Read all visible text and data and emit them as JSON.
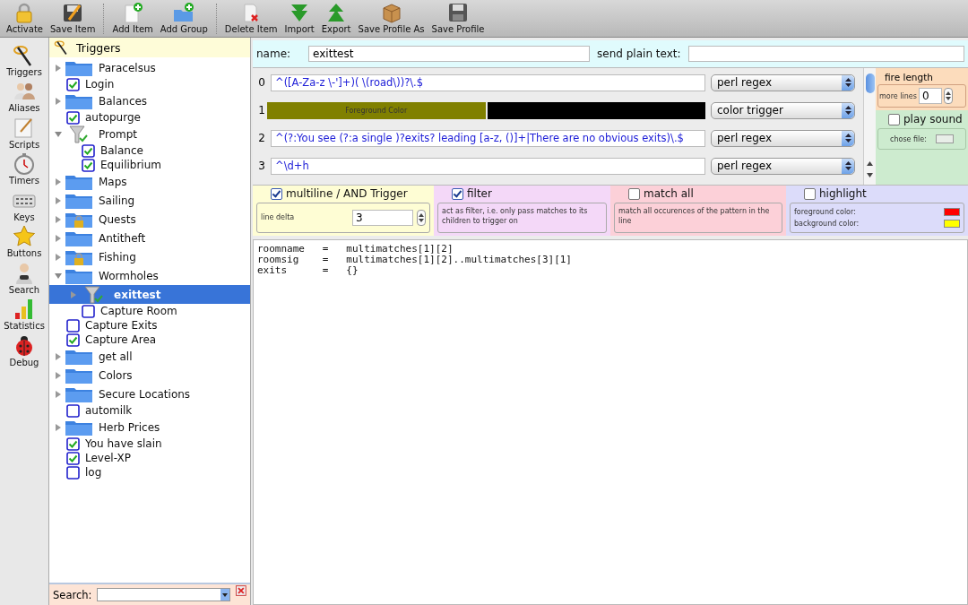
{
  "toolbar": [
    [
      {
        "label": "Activate",
        "kind": "lock"
      },
      {
        "label": "Save Item",
        "kind": "save"
      }
    ],
    [
      {
        "label": "Add Item",
        "kind": "add-item"
      },
      {
        "label": "Add Group",
        "kind": "add-group"
      }
    ],
    [
      {
        "label": "Delete Item",
        "kind": "delete"
      },
      {
        "label": "Import",
        "kind": "import"
      },
      {
        "label": "Export",
        "kind": "export"
      },
      {
        "label": "Save Profile As",
        "kind": "box"
      },
      {
        "label": "Save Profile",
        "kind": "disk"
      }
    ]
  ],
  "sidebar": {
    "items": [
      {
        "label": "Triggers",
        "kind": "wand"
      },
      {
        "label": "Aliases",
        "kind": "people"
      },
      {
        "label": "Scripts",
        "kind": "notepad"
      },
      {
        "label": "Timers",
        "kind": "stopwatch"
      },
      {
        "label": "Keys",
        "kind": "keyboard"
      },
      {
        "label": "Buttons",
        "kind": "star"
      },
      {
        "label": "Search",
        "kind": "person"
      },
      {
        "label": "Statistics",
        "kind": "bars"
      },
      {
        "label": "Debug",
        "kind": "ladybug"
      }
    ]
  },
  "tree": {
    "header": "Triggers",
    "items": [
      {
        "label": "Paracelsus",
        "kind": "folder",
        "locked": false,
        "expanded": false,
        "selected": false
      },
      {
        "label": "Login",
        "kind": "trigger",
        "checked": true,
        "selected": false
      },
      {
        "label": "Balances",
        "kind": "folder",
        "locked": false,
        "expanded": false,
        "selected": false
      },
      {
        "label": "autopurge",
        "kind": "trigger",
        "checked": true,
        "selected": false
      },
      {
        "label": "Prompt",
        "kind": "filter",
        "expanded": true,
        "selected": false,
        "children": [
          {
            "label": "Balance",
            "kind": "trigger",
            "checked": true,
            "selected": false
          },
          {
            "label": "Equilibrium",
            "kind": "trigger",
            "checked": true,
            "selected": false
          }
        ]
      },
      {
        "label": "Maps",
        "kind": "folder",
        "locked": false,
        "expanded": false,
        "selected": false
      },
      {
        "label": "Sailing",
        "kind": "folder",
        "locked": false,
        "expanded": false,
        "selected": false
      },
      {
        "label": "Quests",
        "kind": "folder",
        "locked": true,
        "expanded": false,
        "selected": false
      },
      {
        "label": "Antitheft",
        "kind": "folder",
        "locked": false,
        "expanded": false,
        "selected": false
      },
      {
        "label": "Fishing",
        "kind": "folder",
        "locked": true,
        "expanded": false,
        "selected": false
      },
      {
        "label": "Wormholes",
        "kind": "folder",
        "locked": false,
        "expanded": true,
        "selected": false,
        "children": [
          {
            "label": "exittest",
            "kind": "filter",
            "expanded": false,
            "selected": true
          },
          {
            "label": "Capture Room",
            "kind": "trigger",
            "checked": false,
            "selected": false
          }
        ]
      },
      {
        "label": "Capture Exits",
        "kind": "trigger",
        "checked": false,
        "selected": false
      },
      {
        "label": "Capture Area",
        "kind": "trigger",
        "checked": true,
        "selected": false
      },
      {
        "label": "get all",
        "kind": "folder",
        "locked": false,
        "expanded": false,
        "selected": false
      },
      {
        "label": "Colors",
        "kind": "folder",
        "locked": false,
        "expanded": false,
        "selected": false
      },
      {
        "label": "Secure Locations",
        "kind": "folder",
        "locked": false,
        "expanded": false,
        "selected": false
      },
      {
        "label": "automilk",
        "kind": "trigger",
        "checked": false,
        "selected": false
      },
      {
        "label": "Herb Prices",
        "kind": "folder",
        "locked": false,
        "expanded": false,
        "selected": false
      },
      {
        "label": "You have slain",
        "kind": "trigger",
        "checked": true,
        "selected": false
      },
      {
        "label": "Level-XP",
        "kind": "trigger",
        "checked": true,
        "selected": false
      },
      {
        "label": "log",
        "kind": "trigger",
        "checked": false,
        "selected": false
      }
    ]
  },
  "search": {
    "label": "Search:"
  },
  "name_label": "name:",
  "name_value": "exittest",
  "send_label": "send plain text:",
  "patterns": [
    {
      "number": "0",
      "kind": "text",
      "value": "^([A-Za-z \\-']+)( \\(road\\))?\\.$",
      "type": "perl regex"
    },
    {
      "number": "1",
      "kind": "color",
      "foreground": {
        "label": "Foreground Color",
        "color": "#808000"
      },
      "background": {
        "color": "#000000"
      },
      "type": "color trigger"
    },
    {
      "number": "2",
      "kind": "text",
      "value": "^(?:You see (?:a single )?exits? leading [a-z, ()]+|There are no obvious exits)\\.$",
      "type": "perl regex"
    },
    {
      "number": "3",
      "kind": "text",
      "value": "^\\d+h",
      "type": "perl regex"
    }
  ],
  "fire_length": {
    "title": "fire length",
    "label": "more lines",
    "value": "0"
  },
  "play_sound": {
    "label": "play sound",
    "checked": false,
    "file_label": "chose file:"
  },
  "options": {
    "multiline": {
      "label": "multiline / AND Trigger",
      "checked": true,
      "delta_label": "line delta",
      "delta_value": "3"
    },
    "filter": {
      "label": "filter",
      "checked": true,
      "description": "act as filter, i.e. only pass matches to its children to trigger on"
    },
    "match_all": {
      "label": "match all",
      "checked": false,
      "description": "match all occurences of the pattern in the line"
    },
    "highlight": {
      "label": "highlight",
      "checked": false,
      "foreground": {
        "label": "foreground color:",
        "color": "#ff0000"
      },
      "background": {
        "label": "background color:",
        "color": "#ffff00"
      }
    }
  },
  "script": "roomname   =   multimatches[1][2]\nroomsig    =   multimatches[1][2]..multimatches[3][1]\nexits      =   {}"
}
